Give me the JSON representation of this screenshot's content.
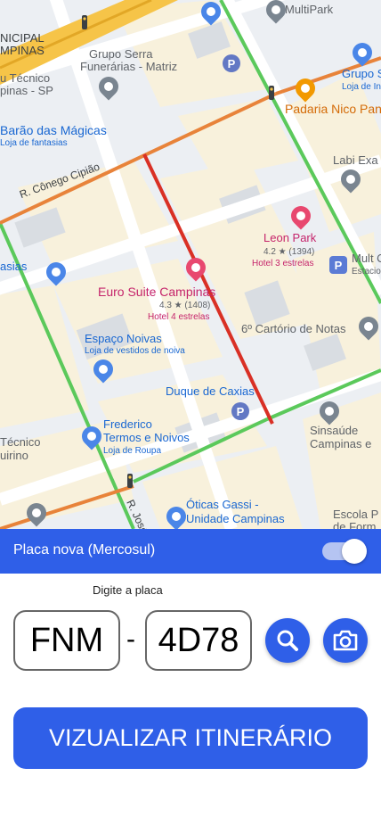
{
  "map": {
    "labels": {
      "municipal": "NICIPAL",
      "campinas_top": "MPINAS",
      "tecnico_top": "u Técnico",
      "campinas_sp": "pinas - SP",
      "grupo_serra": "Grupo Serra",
      "funerarias": "Funerárias - Matriz",
      "multipark": "MultiPark",
      "bemfunciona": "Estacionamento",
      "grupo_s": "Grupo S",
      "loja_de_ir": "Loja de In",
      "padaria": "Padaria Nico Pan",
      "barao": "Barão das Mágicas",
      "loja_fantasias": "Loja de fantasias",
      "conego": "R. Cônego Cipião",
      "labi": "Labi Exa",
      "leon_park": "Leon Park",
      "leon_rating": "4.2 ★ (1394)",
      "leon_type": "Hotel 3 estrelas",
      "mult_c": "Mult C",
      "estacio": "Estacio",
      "tasias": "asias",
      "euro_suite": "Euro Suite Campinas",
      "euro_rating": "4.3 ★ (1408)",
      "euro_type": "Hotel 4 estrelas",
      "cartorio": "6º Cartório de Notas",
      "espaco_noivas": "Espaço Noivas",
      "loja_vestidos": "Loja de vestidos de noiva",
      "duque": "Duque de Caxias",
      "frederico1": "Frederico",
      "frederico2": "Termos e Noivos",
      "loja_roupa": "Loja de Roupa",
      "sinsaude1": "Sinsaúde",
      "sinsaude2": "Campinas e",
      "tecnico_bottom": "Técnico",
      "uirino": "uirino",
      "oticas1": "Óticas Gassi -",
      "oticas2": "Unidade Campinas",
      "rua_jose": "R. José",
      "escola1": "Escola P",
      "escola2": "de Form"
    }
  },
  "toggle": {
    "label": "Placa nova (Mercosul)",
    "state": "on"
  },
  "plate": {
    "hint": "Digite a placa",
    "letters": "FNM",
    "separator": "-",
    "numbers": "4D78"
  },
  "actions": {
    "itinerary_label": "VIZUALIZAR ITINERÁRIO"
  },
  "colors": {
    "accent": "#2f5fe8",
    "route": "#d93025",
    "road_green": "#5bc95b",
    "road_orange": "#e8833a"
  }
}
